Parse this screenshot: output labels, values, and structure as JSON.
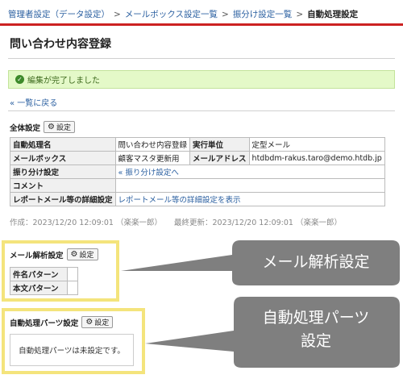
{
  "breadcrumb": {
    "items": [
      "管理者設定（データ設定）",
      "メールボックス設定一覧",
      "振分け設定一覧"
    ],
    "current": "自動処理設定",
    "separator": ">"
  },
  "page": {
    "title": "問い合わせ内容登録"
  },
  "alert": {
    "message": "編集が完了しました"
  },
  "back_link": "« 一覧に戻る",
  "overall": {
    "label": "全体設定",
    "button": "設定",
    "rows": {
      "name_label": "自動処理名",
      "name_value": "問い合わせ内容登録",
      "unit_label": "実行単位",
      "unit_value": "定型メール",
      "mailbox_label": "メールボックス",
      "mailbox_value": "顧客マスタ更新用",
      "address_label": "メールアドレス",
      "address_value": "htdbdm-rakus.taro@demo.htdb.jp",
      "sort_label": "振り分け設定",
      "sort_value": "« 振り分け設定へ",
      "comment_label": "コメント",
      "comment_value": "",
      "report_label": "レポートメール等の詳細設定",
      "report_value": "レポートメール等の詳細設定を表示"
    }
  },
  "meta": {
    "created": "作成：2023/12/20 12:09:01 （楽楽一郎）",
    "updated": "最終更新：2023/12/20 12:09:01 （楽楽一郎）"
  },
  "mail_parse": {
    "label": "メール解析設定",
    "button": "設定",
    "rows": [
      "件名パターン",
      "本文パターン"
    ]
  },
  "auto_parts": {
    "label": "自動処理パーツ設定",
    "button": "設定",
    "empty_message": "自動処理パーツは未設定です。"
  },
  "callouts": {
    "mail_parse": "メール解析設定",
    "auto_parts_line1": "自動処理パーツ",
    "auto_parts_line2": "設定"
  },
  "colors": {
    "link": "#2a5fa0",
    "header_rule": "#cc2222",
    "alert_bg": "#e4f9c8",
    "highlight_frame": "#f4e47c",
    "callout_bg": "#7f7f7f"
  }
}
